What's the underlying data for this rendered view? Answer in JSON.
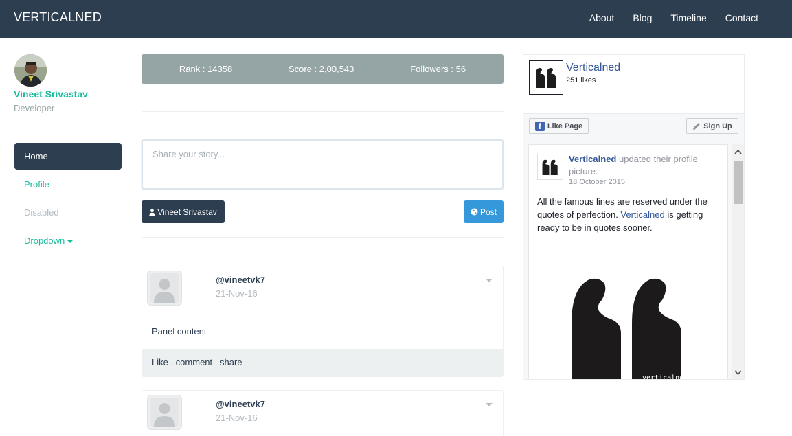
{
  "navbar": {
    "brand": "VERTICALNED",
    "links": [
      "About",
      "Blog",
      "Timeline",
      "Contact"
    ]
  },
  "profile": {
    "name": "Vineet Srivastav",
    "role": "Developer",
    "role_suffix": "··"
  },
  "sidebar": {
    "items": [
      {
        "label": "Home",
        "state": "active"
      },
      {
        "label": "Profile",
        "state": "normal"
      },
      {
        "label": "Disabled",
        "state": "disabled"
      },
      {
        "label": "Dropdown",
        "state": "dropdown"
      }
    ]
  },
  "stats": {
    "rank": "Rank : 14358",
    "score": "Score : 2,00,543",
    "followers": "Followers : 56"
  },
  "composer": {
    "placeholder": "Share your story...",
    "user_button": "Vineet Srivastav",
    "post_button": "Post"
  },
  "posts": [
    {
      "user": "@vineetvk7",
      "date": "21-Nov-16",
      "body": "Panel content",
      "footer": "Like . comment . share"
    },
    {
      "user": "@vineetvk7",
      "date": "21-Nov-16"
    }
  ],
  "facebook_widget": {
    "page_name": "Verticalned",
    "likes": "251 likes",
    "like_button": "Like Page",
    "signup_button": "Sign Up",
    "story": {
      "author": "Verticalned",
      "action": " updated their profile picture.",
      "date": "18 October 2015",
      "text_before": "All the famous lines are reserved under the quotes of perfection. ",
      "text_link": "Verticalned",
      "text_after": " is getting ready to be in quotes sooner.",
      "image_caption": "verticalned"
    }
  },
  "colors": {
    "navbar": "#2c3e50",
    "accent": "#18bc9c",
    "stats_bar": "#95a5a6",
    "post_button": "#3498db",
    "facebook_blue": "#365899"
  }
}
